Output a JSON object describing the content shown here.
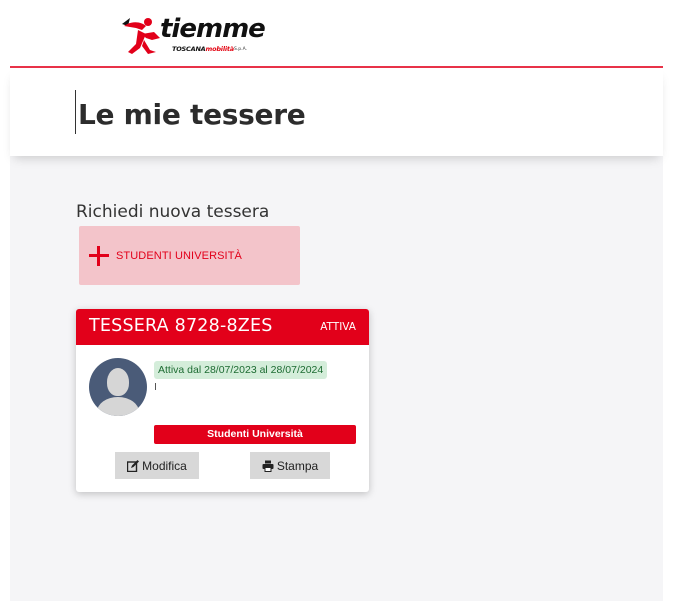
{
  "brand": {
    "name": "tiemme",
    "sub_black": "TOSCANA",
    "sub_red": "mobilità",
    "suffix": "S.p.A.",
    "accent_color": "#e2001a"
  },
  "page": {
    "title": "Le mie tessere"
  },
  "request": {
    "label": "Richiedi nuova tessera",
    "button_label": "STUDENTI UNIVERSITÀ",
    "button_icon": "plus-icon"
  },
  "card": {
    "title": "TESSERA 8728-8ZES",
    "status": "ATTIVA",
    "validity": "Attiva dal 28/07/2023 al 28/07/2024",
    "type": "Studenti Università",
    "avatar_icon": "user-avatar-icon",
    "edit_label": "Modifica",
    "edit_icon": "edit-icon",
    "print_label": "Stampa",
    "print_icon": "printer-icon"
  }
}
